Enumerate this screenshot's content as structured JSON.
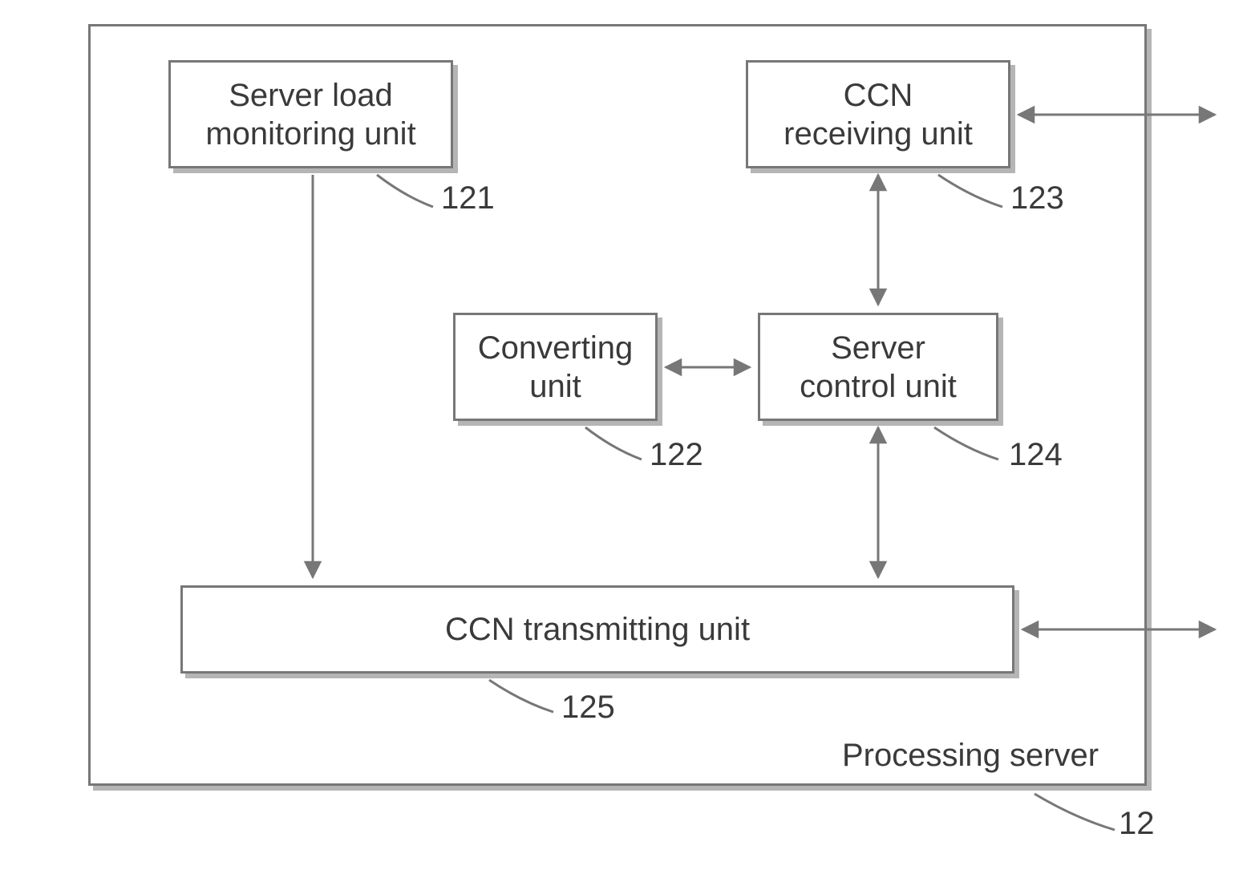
{
  "outer": {
    "label": "Processing server",
    "ref": "12"
  },
  "boxes": {
    "b121": {
      "label": "Server load\nmonitoring unit",
      "ref": "121"
    },
    "b122": {
      "label": "Converting\nunit",
      "ref": "122"
    },
    "b123": {
      "label": "CCN\nreceiving unit",
      "ref": "123"
    },
    "b124": {
      "label": "Server\ncontrol unit",
      "ref": "124"
    },
    "b125": {
      "label": "CCN transmitting unit",
      "ref": "125"
    }
  },
  "connections": [
    {
      "from": "b121",
      "to": "b125",
      "type": "uni"
    },
    {
      "from": "b122",
      "to": "b124",
      "type": "bi"
    },
    {
      "from": "b123",
      "to": "b124",
      "type": "bi"
    },
    {
      "from": "b124",
      "to": "b125",
      "type": "bi"
    },
    {
      "from": "b123",
      "to": "external",
      "type": "bi"
    },
    {
      "from": "b125",
      "to": "external",
      "type": "bi"
    }
  ]
}
